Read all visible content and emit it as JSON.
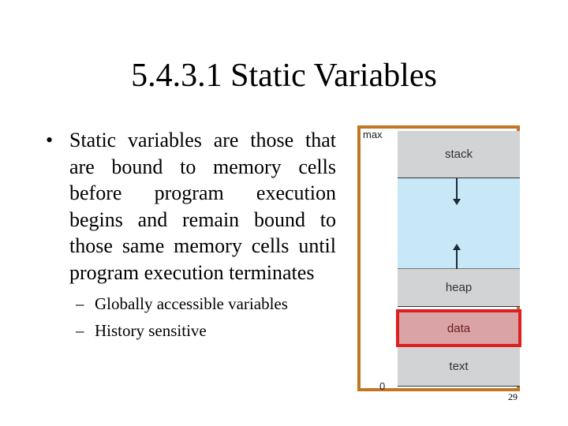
{
  "slide": {
    "title": "5.4.3.1 Static Variables",
    "bullet": {
      "symbol": "•",
      "text": "Static variables are those that are bound to memory cells before program execution begins and remain bound to those same memory cells until program execution terminates"
    },
    "sub_bullets": [
      {
        "symbol": "–",
        "text": "Globally accessible variables"
      },
      {
        "symbol": "–",
        "text": "History sensitive"
      }
    ],
    "page_number": "29"
  },
  "diagram": {
    "top_label": "max",
    "bottom_label": "0",
    "segments": [
      {
        "name": "stack",
        "label": "stack"
      },
      {
        "name": "free",
        "label": ""
      },
      {
        "name": "heap",
        "label": "heap"
      },
      {
        "name": "data",
        "label": "data",
        "highlighted": true
      },
      {
        "name": "text",
        "label": "text"
      }
    ],
    "colors": {
      "frame": "#c27624",
      "segment_gray": "#d2d3d5",
      "free_space": "#c8e7f7",
      "data_fill": "#daa3a6",
      "highlight_border": "#dd1f1f"
    }
  }
}
